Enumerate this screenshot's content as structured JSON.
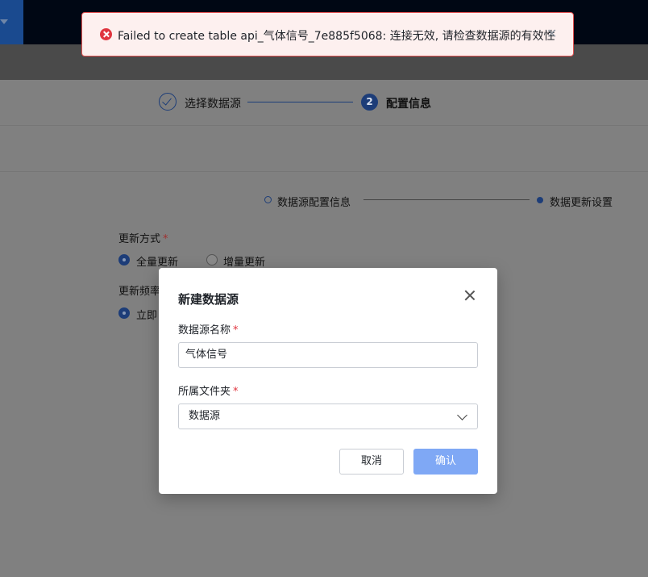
{
  "toast": {
    "message": "Failed to create table api_气体信号_7e885f5068: 连接无效, 请检查数据源的有效性",
    "close_glyph": "✕",
    "icon": "error-circle-icon"
  },
  "steps": {
    "step1_label": "选择数据源",
    "step2_number": "2",
    "step2_label": "配置信息"
  },
  "substeps": {
    "first_label": "数据源配置信息",
    "second_label": "数据更新设置"
  },
  "update_mode": {
    "label": "更新方式",
    "required": "*",
    "options": [
      "全量更新",
      "增量更新"
    ],
    "selected": "全量更新"
  },
  "update_freq": {
    "label_visible": "更新频率",
    "option_visible": "立即"
  },
  "modal": {
    "title": "新建数据源",
    "name_label": "数据源名称",
    "name_required": "*",
    "name_value": "气体信号",
    "folder_label": "所属文件夹",
    "folder_required": "*",
    "folder_value": "数据源",
    "cancel_label": "取消",
    "confirm_label": "确认"
  },
  "colors": {
    "primary": "#3370ff",
    "confirm_disabled": "#7fa8f5",
    "error": "#e0353f"
  }
}
